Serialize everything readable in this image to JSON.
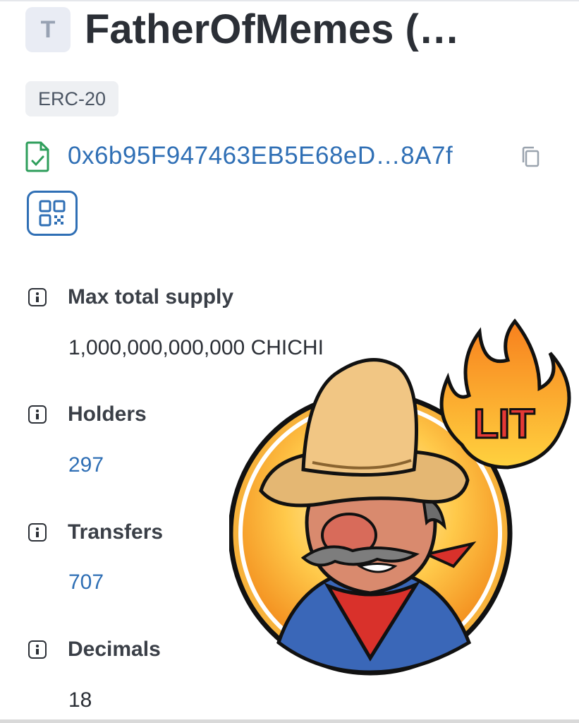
{
  "header": {
    "avatar_letter": "T",
    "title": "FatherOfMemes (…"
  },
  "badge": "ERC-20",
  "address": {
    "text": "0x6b95F947463EB5E68eD…8A7f",
    "icons": [
      "contract-file-icon",
      "copy-icon",
      "qr-code-icon"
    ]
  },
  "stats": [
    {
      "label": "Max total supply",
      "value": "1,000,000,000,000 CHICHI"
    },
    {
      "label": "Holders",
      "value": "297"
    },
    {
      "label": "Transfers",
      "value": "707"
    },
    {
      "label": "Decimals",
      "value": "18"
    }
  ],
  "sticker": {
    "text": "LIT",
    "icons": [
      "mascot-sombrero-icon",
      "flame-icon"
    ]
  },
  "colors": {
    "link": "#2f6fb5",
    "contract_green": "#2e9e5b",
    "badge_bg": "#eef0f3",
    "flame_orange": "#f7931e",
    "lit_red": "#e53935"
  }
}
